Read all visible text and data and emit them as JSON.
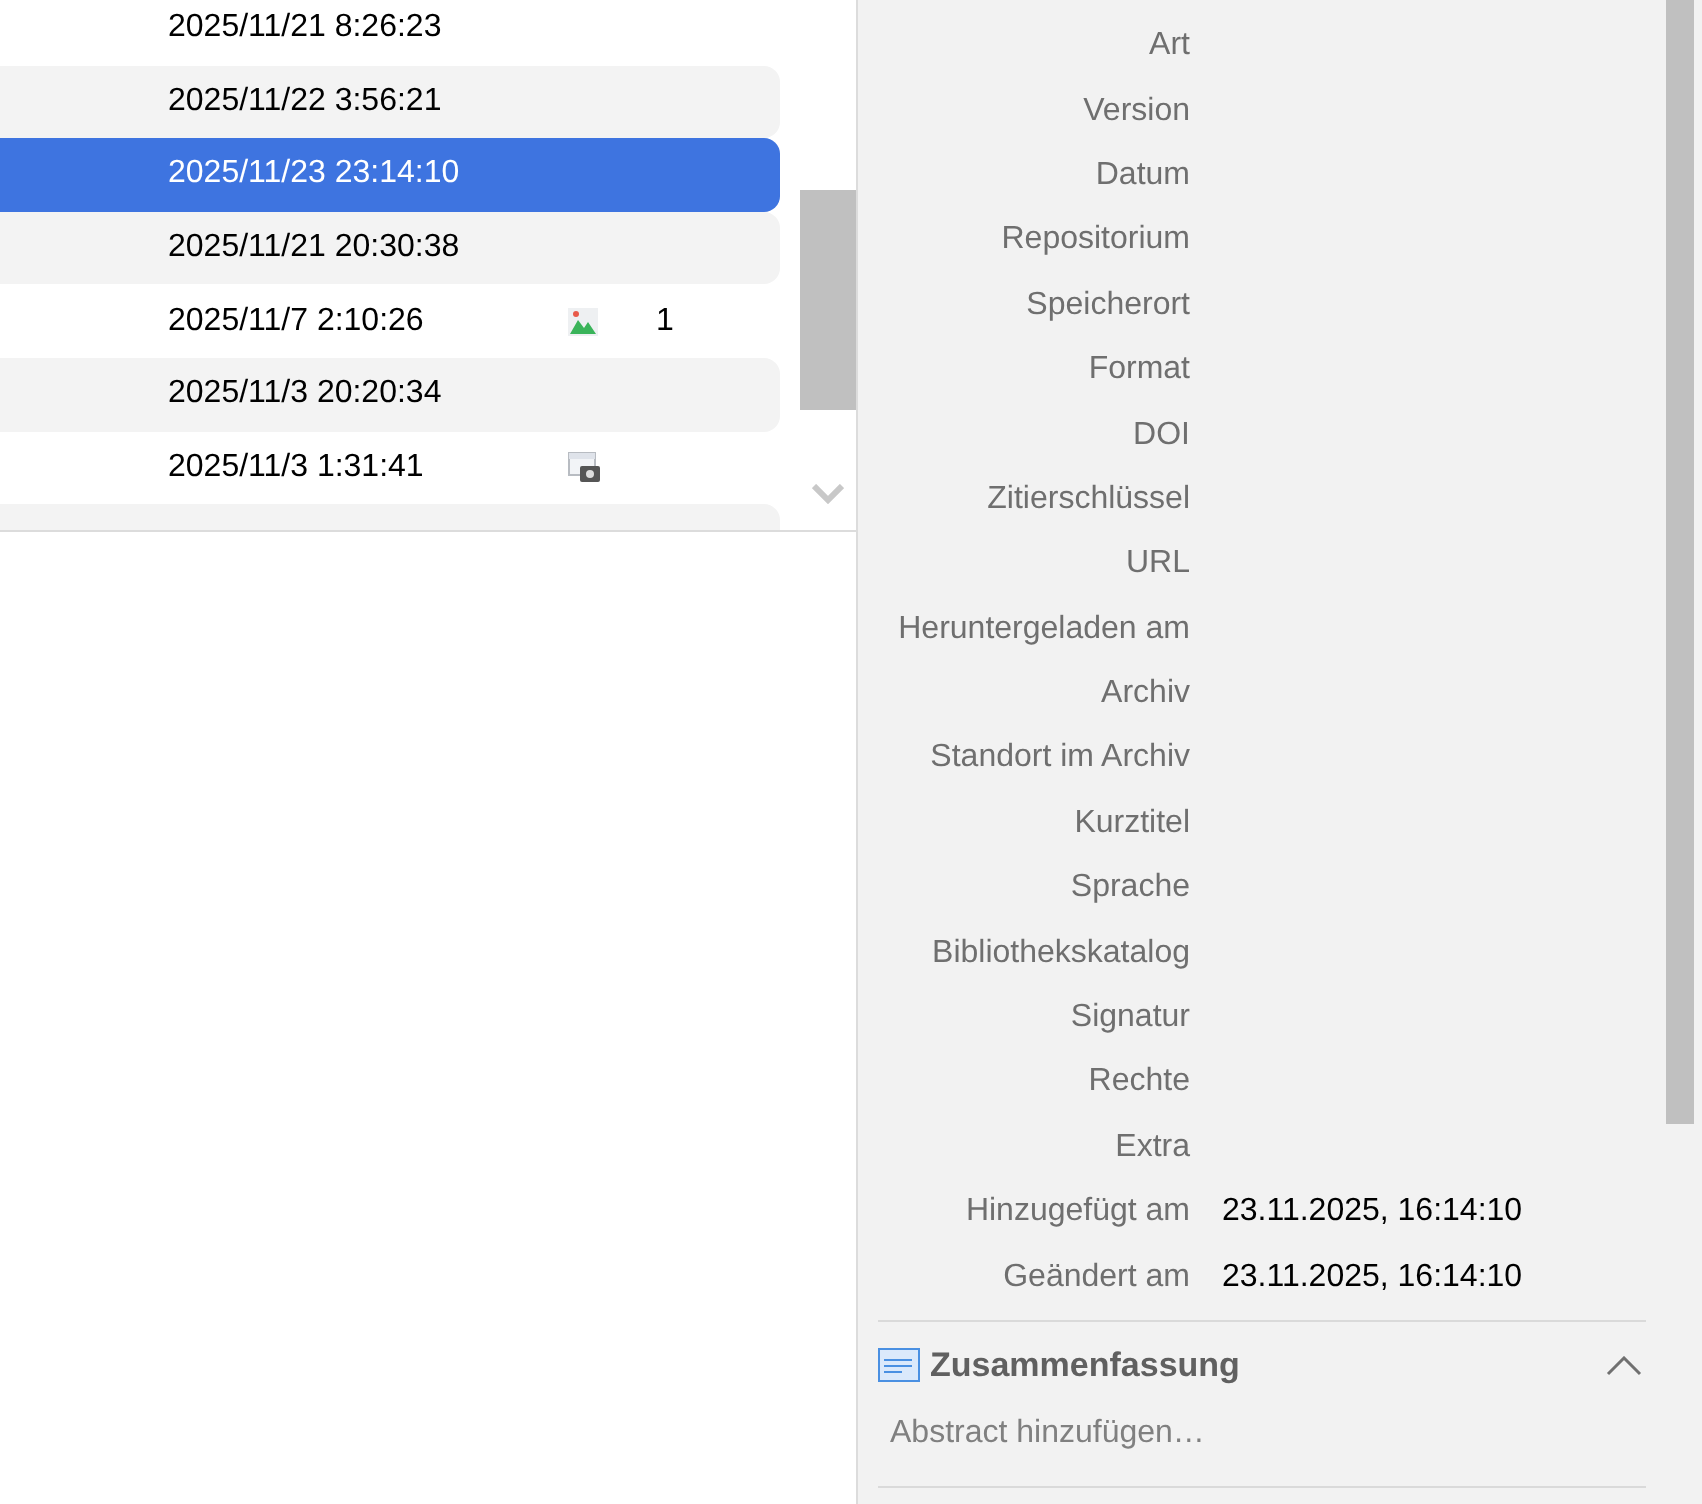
{
  "item_list": {
    "rows": [
      {
        "kind": "plain",
        "date": "2025/11/21 8:26:23",
        "selected": false
      },
      {
        "kind": "plain",
        "date": "2025/11/22 3:56:21",
        "selected": false
      },
      {
        "kind": "plain",
        "date": "2025/11/23 23:14:10",
        "selected": true
      },
      {
        "kind": "plain",
        "date": "2025/11/21 20:30:38",
        "selected": false
      },
      {
        "kind": "image",
        "date": "2025/11/7 2:10:26",
        "selected": false,
        "count": "1"
      },
      {
        "kind": "plain",
        "date": "2025/11/3 20:20:34",
        "selected": false
      },
      {
        "kind": "snapshot",
        "date": "2025/11/3 1:31:41",
        "selected": false
      }
    ]
  },
  "info": {
    "fields": [
      {
        "label": "Art"
      },
      {
        "label": "Version"
      },
      {
        "label": "Datum"
      },
      {
        "label": "Repositorium"
      },
      {
        "label": "Speicherort"
      },
      {
        "label": "Format"
      },
      {
        "label": "DOI"
      },
      {
        "label": "Zitierschlüssel"
      },
      {
        "label": "URL"
      },
      {
        "label": "Heruntergeladen am"
      },
      {
        "label": "Archiv"
      },
      {
        "label": "Standort im Archiv"
      },
      {
        "label": "Kurztitel"
      },
      {
        "label": "Sprache"
      },
      {
        "label": "Bibliothekskatalog"
      },
      {
        "label": "Signatur"
      },
      {
        "label": "Rechte"
      },
      {
        "label": "Extra"
      },
      {
        "label": "Hinzugefügt am",
        "value": "23.11.2025, 16:14:10"
      },
      {
        "label": "Geändert am",
        "value": "23.11.2025, 16:14:10"
      }
    ]
  },
  "abstract": {
    "title": "Zusammenfassung",
    "expanded": true,
    "placeholder": "Abstract hinzufügen…"
  }
}
